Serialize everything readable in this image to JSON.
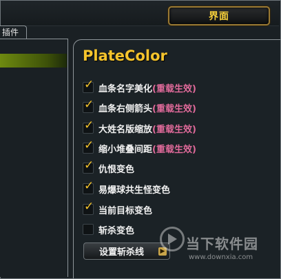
{
  "window": {
    "title": "界面"
  },
  "left_tab": {
    "label": "插件"
  },
  "panel": {
    "heading": "PlateColor"
  },
  "options": [
    {
      "label": "血条名字美化",
      "note": "(重载生效)",
      "checked": true
    },
    {
      "label": "血条右侧箭头",
      "note": "(重载生效)",
      "checked": true
    },
    {
      "label": "大姓名版缩放",
      "note": "(重载生效)",
      "checked": true
    },
    {
      "label": "缩小堆叠间距",
      "note": "(重载生效)",
      "checked": true
    },
    {
      "label": "仇恨变色",
      "note": "",
      "checked": true
    },
    {
      "label": "易爆球共生怪变色",
      "note": "",
      "checked": true
    },
    {
      "label": "当前目标变色",
      "note": "",
      "checked": true
    },
    {
      "label": "斩杀变色",
      "note": "",
      "checked": false
    }
  ],
  "button": {
    "label": "设置斩杀线"
  },
  "watermark": {
    "main": "当下软件园",
    "url": "www.downxia.com"
  },
  "colors": {
    "accent_gold": "#f5c42c",
    "note_pink": "#e06a9a",
    "highlight_green": "#6e8a10"
  }
}
